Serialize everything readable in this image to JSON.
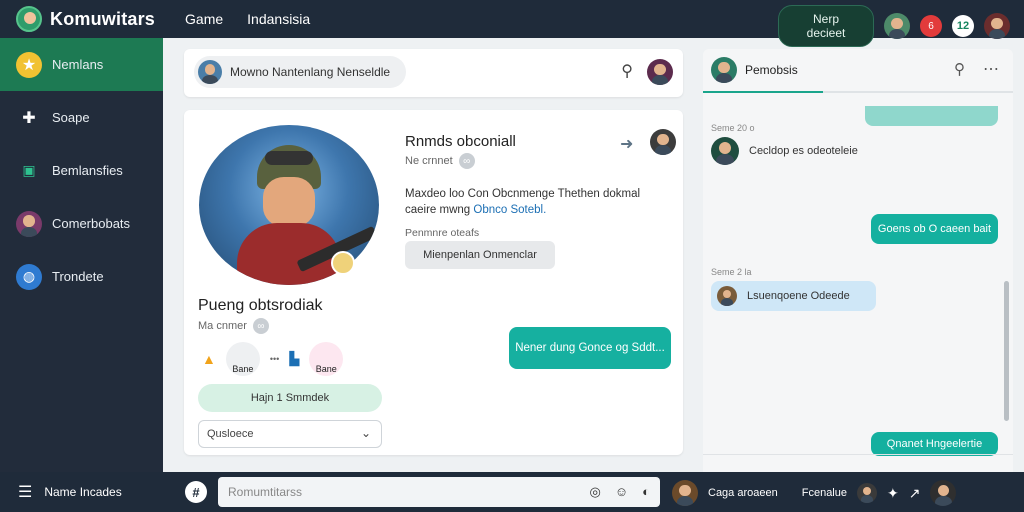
{
  "header": {
    "brand": "Komuwitars",
    "nav": [
      "Game",
      "Indansisia"
    ],
    "new_button": "Nerp decieet",
    "notif_count": "6"
  },
  "sidebar": {
    "items": [
      {
        "label": "Nemlans",
        "icon": "star-icon",
        "active": true
      },
      {
        "label": "Soape",
        "icon": "puzzle-icon"
      },
      {
        "label": "Bemlansfies",
        "icon": "screen-icon"
      },
      {
        "label": "Comerbobats",
        "icon": "avatar-icon"
      },
      {
        "label": "Trondete",
        "icon": "globe-icon"
      }
    ]
  },
  "search": {
    "placeholder": "Mowno Nantenlang Nenseldle"
  },
  "profile": {
    "name": "Pueng obtsrodiak",
    "sub": "Ma cnmer",
    "emoji_labels": [
      "Bane",
      "Bane"
    ],
    "follow_button": "Hajn 1 Smmdek",
    "select_value": "Qusloece"
  },
  "post": {
    "title": "Rnmds obconiall",
    "sub": "Ne crnnet",
    "body_text": "Maxdeo loo Con Obcnmenge Thethen dokmal caeire mwng ",
    "body_link": "Obnco Sotebl.",
    "sub_label": "Penmnre oteafs",
    "chip_label": "Mienpenlan Onmenclar",
    "bubble": "Nener dung Gonce og Sddt..."
  },
  "chat": {
    "title": "Pemobsis",
    "messages": [
      {
        "time": "Seme 20 o"
      },
      {
        "text": "Cecldop es odeoteleie"
      },
      {
        "text": "Goens ob O caeen bait"
      },
      {
        "time": "Seme 2 la"
      },
      {
        "text": "Lsuenqoene Odeede"
      },
      {
        "text": "Qnanet Hngeelertie"
      }
    ]
  },
  "bottombar": {
    "menu_label": "Name Incades",
    "composer_placeholder": "Romumtitarss",
    "user_label": "Caga aroaeen",
    "right_label": "Fcenalue"
  },
  "colors": {
    "topbar": "#1f2b3a",
    "accent_green": "#1d7a53",
    "bubble_teal": "#16b0a0"
  }
}
